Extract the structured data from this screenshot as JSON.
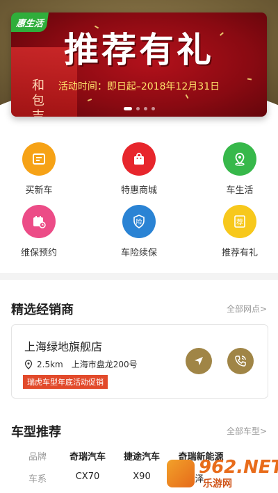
{
  "banner": {
    "logo": "惠生活",
    "title": "推荐有礼",
    "subtitle": "活动时间：即日起–2018年12月31日",
    "building_text": "和包吉",
    "page_count": 4,
    "active_page": 1
  },
  "menu": {
    "items": [
      {
        "label": "买新车",
        "icon": "document-icon",
        "color": "#f6a216"
      },
      {
        "label": "特惠商城",
        "icon": "shopping-bag-icon",
        "color": "#e7262c"
      },
      {
        "label": "车生活",
        "icon": "location-pin-icon",
        "color": "#37b84a"
      },
      {
        "label": "维保预约",
        "icon": "calendar-icon",
        "color": "#ec4c87"
      },
      {
        "label": "车险续保",
        "icon": "shield-icon",
        "color": "#2a83d4",
        "glyph": "险"
      },
      {
        "label": "推荐有礼",
        "icon": "recommend-icon",
        "color": "#f7c81c",
        "glyph": "荐"
      }
    ]
  },
  "dealers": {
    "title": "精选经销商",
    "more": "全部网点>",
    "card": {
      "name": "上海绿地旗舰店",
      "distance": "2.5km",
      "address": "上海市盘龙200号",
      "tag": "瑞虎车型年底活动促销"
    }
  },
  "models": {
    "title": "车型推荐",
    "more": "全部车型>",
    "brand_label": "品牌",
    "series_label": "车系",
    "brands": [
      "奇瑞汽车",
      "捷途汽车",
      "奇瑞新能源"
    ],
    "series": [
      "CX70",
      "X90",
      "艾瑞泽"
    ]
  },
  "watermark": {
    "number": "962.NET",
    "text": "乐游网"
  },
  "colors": {
    "gold": "#a08546",
    "tag_red": "#e24a2b"
  }
}
